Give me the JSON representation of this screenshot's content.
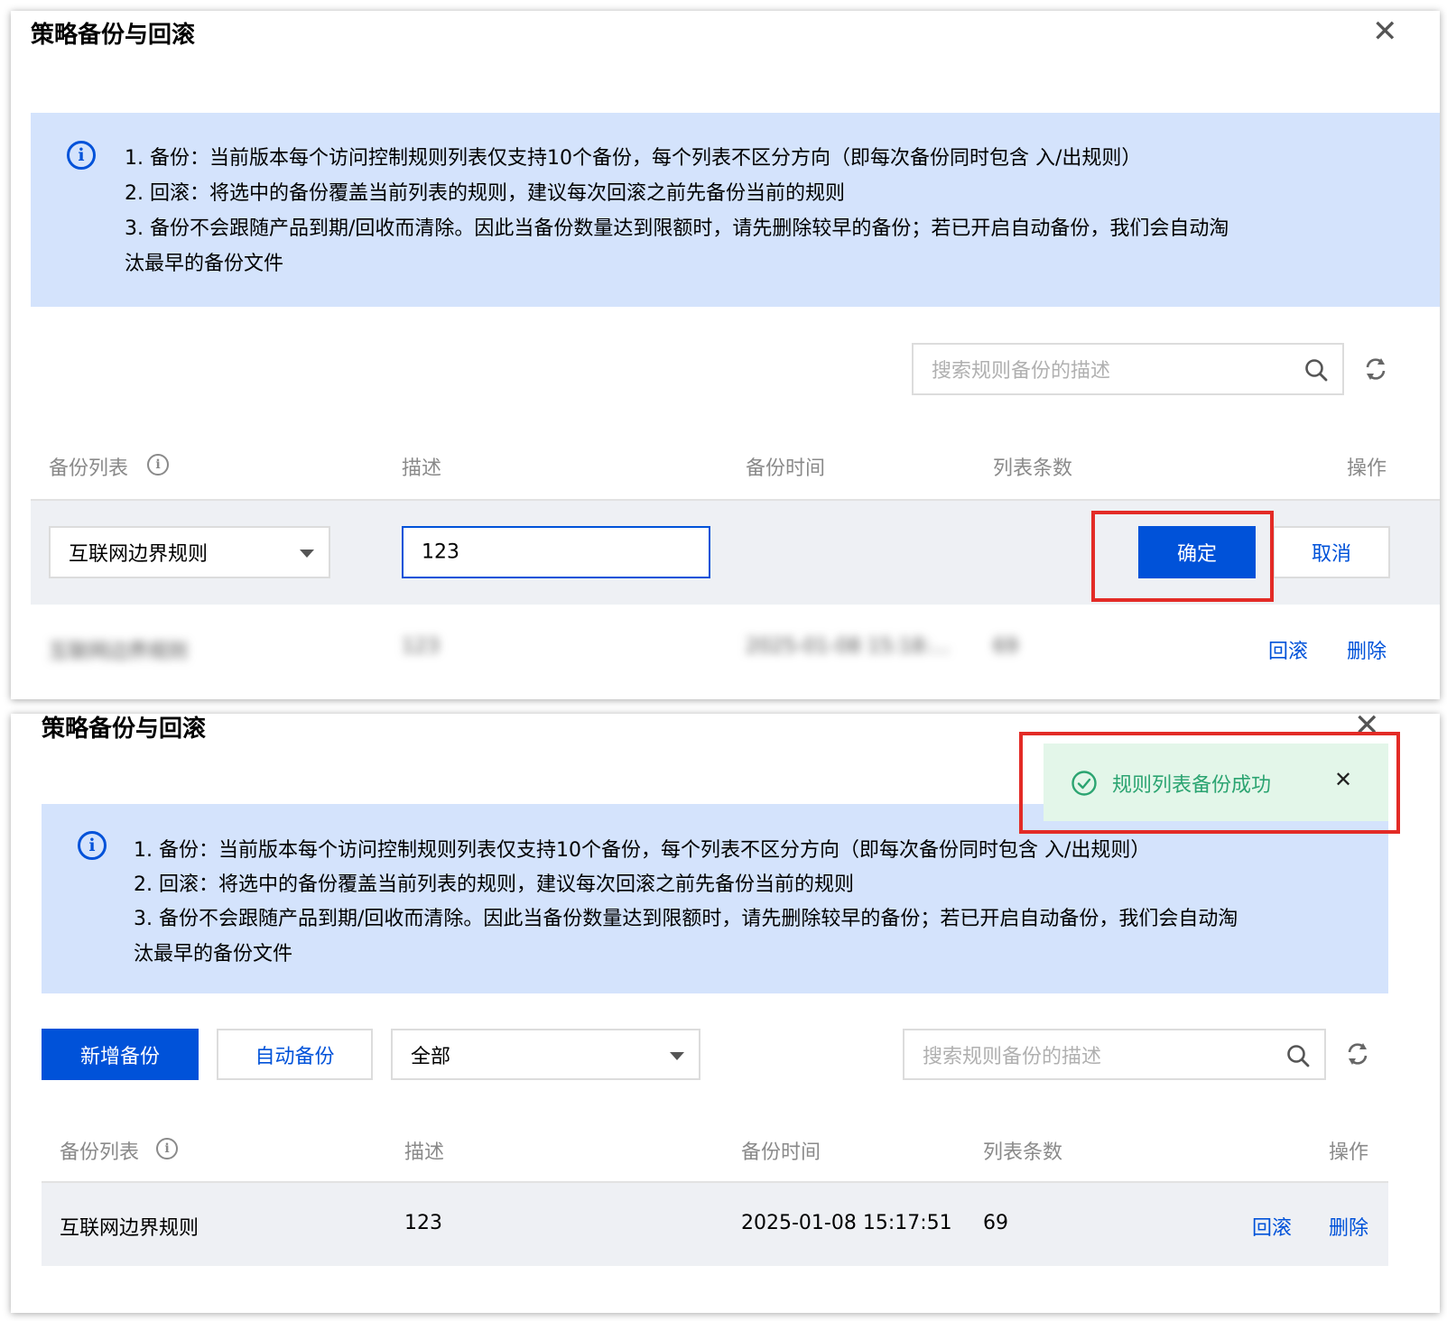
{
  "dialog": {
    "title": "策略备份与回滚",
    "close": "✕"
  },
  "notice": {
    "icon": "i",
    "lines": [
      "1. 备份：当前版本每个访问控制规则列表仅支持10个备份，每个列表不区分方向（即每次备份同时包含 入/出规则）",
      "2. 回滚：将选中的备份覆盖当前列表的规则，建议每次回滚之前先备份当前的规则",
      "3. 备份不会跟随产品到期/回收而清除。因此当备份数量达到限额时，请先删除较早的备份；若已开启自动备份，我们会自动淘",
      "汰最早的备份文件"
    ]
  },
  "search": {
    "placeholder": "搜索规则备份的描述"
  },
  "table": {
    "headers": [
      "备份列表",
      "描述",
      "备份时间",
      "列表条数",
      "操作"
    ]
  },
  "edit_row": {
    "list_select": "互联网边界规则",
    "description_value": "123",
    "confirm_label": "确定",
    "cancel_label": "取消"
  },
  "blurred_row": {
    "list": "互联网边界规则",
    "description": "123",
    "time": "2025-01-08 15:18:...",
    "count": "69",
    "rollback": "回滚",
    "delete": "删除"
  },
  "toolbar": {
    "add_label": "新增备份",
    "auto_label": "自动备份",
    "filter_value": "全部"
  },
  "toast": {
    "message": "规则列表备份成功",
    "close": "✕"
  },
  "result_row": {
    "list": "互联网边界规则",
    "description": "123",
    "time": "2025-01-08 15:17:51",
    "count": "69",
    "rollback": "回滚",
    "delete": "删除"
  },
  "colors": {
    "primary": "#0052d9",
    "notice_bg": "#d4e3fc",
    "highlight": "#e32b26",
    "success": "#2ba471",
    "toast_bg": "#e3f6e9"
  }
}
